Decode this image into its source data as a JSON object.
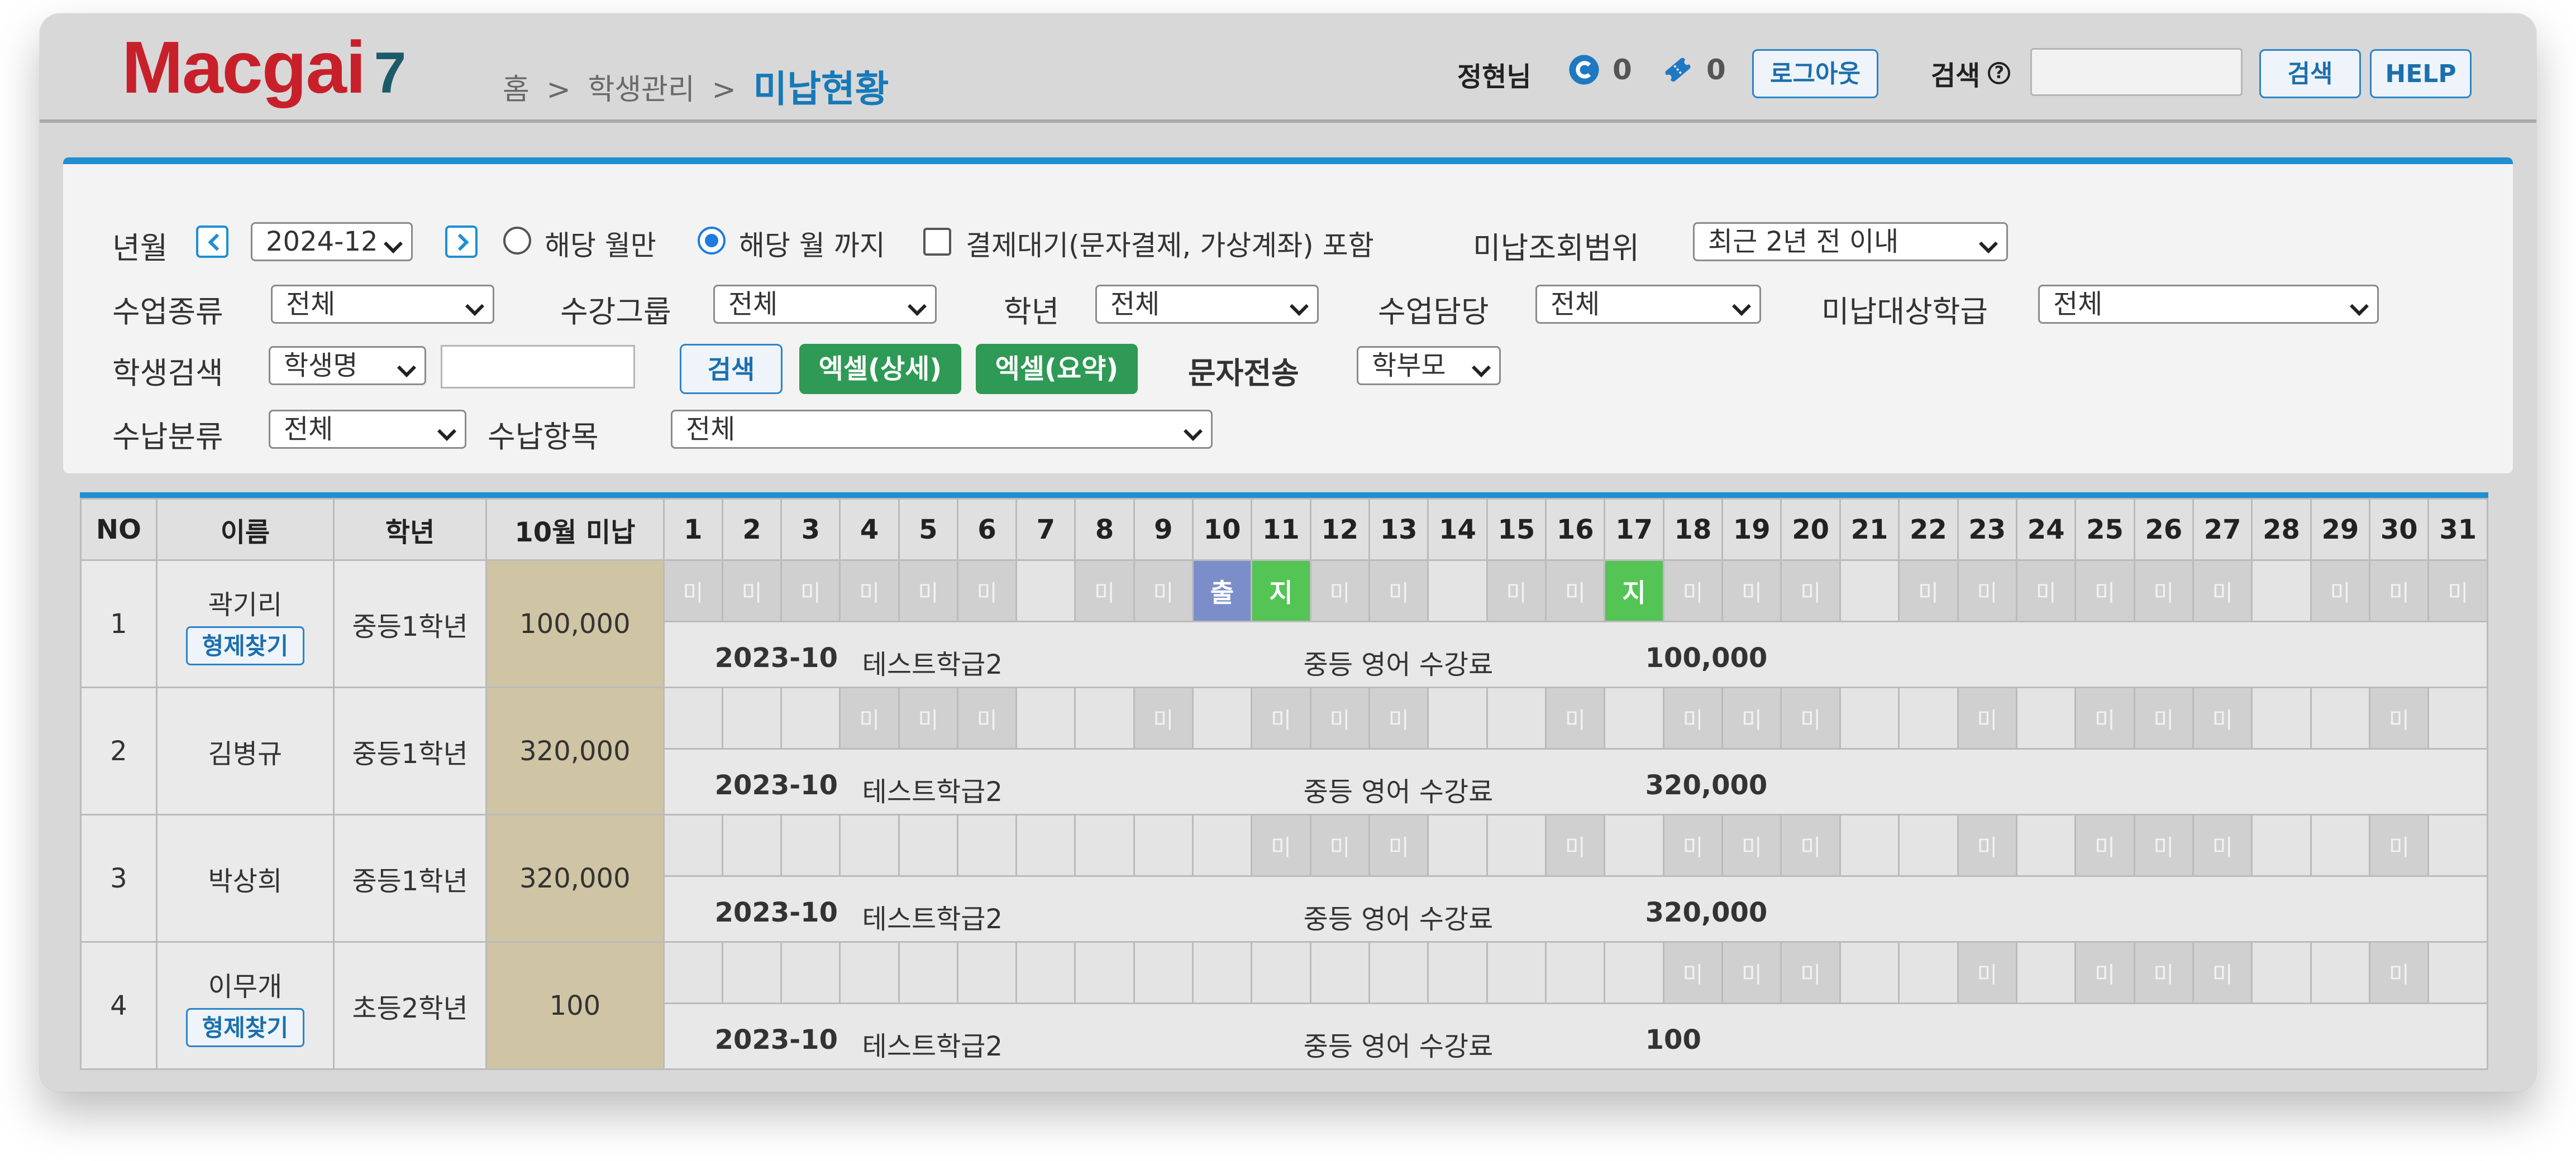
{
  "header": {
    "logo_main": "Macgai",
    "logo_num": "7",
    "breadcrumb": {
      "home": "홈",
      "sep1": ">",
      "section": "학생관리",
      "sep2": ">",
      "current": "미납현황"
    },
    "user_name": "정현님",
    "stat_1_value": "0",
    "stat_1_icon": "coin-icon",
    "stat_2_value": "0",
    "stat_2_icon": "ticket-icon",
    "logout_label": "로그아웃",
    "search_label": "검색",
    "search_help_glyph": "?",
    "search_button": "검색",
    "help_button": "HELP"
  },
  "filters": {
    "year_month_label": "년월",
    "year_month_value": "2024-12",
    "radio_month_only": "해당 월만",
    "radio_until_month": "해당 월 까지",
    "pending_checkbox_label": "결제대기(문자결제, 가상계좌) 포함",
    "range_label": "미납조회범위",
    "range_value": "최근 2년 전 이내",
    "class_type_label": "수업종류",
    "class_type_value": "전체",
    "group_label": "수강그룹",
    "group_value": "전체",
    "grade_label": "학년",
    "grade_value": "전체",
    "teacher_label": "수업담당",
    "teacher_value": "전체",
    "target_class_label": "미납대상학급",
    "target_class_value": "전체",
    "student_search_label": "학생검색",
    "student_search_field": "학생명",
    "search_button": "검색",
    "excel_detail_button": "엑셀(상세)",
    "excel_summary_button": "엑셀(요약)",
    "sms_label": "문자전송",
    "sms_target": "학부모",
    "payment_type_label": "수납분류",
    "payment_type_value": "전체",
    "payment_item_label": "수납항목",
    "payment_item_value": "전체"
  },
  "table": {
    "headers": {
      "no": "NO",
      "name": "이름",
      "grade": "학년",
      "unpaid": "10월 미납"
    },
    "days": [
      "1",
      "2",
      "3",
      "4",
      "5",
      "6",
      "7",
      "8",
      "9",
      "10",
      "11",
      "12",
      "13",
      "14",
      "15",
      "16",
      "17",
      "18",
      "19",
      "20",
      "21",
      "22",
      "23",
      "24",
      "25",
      "26",
      "27",
      "28",
      "29",
      "30",
      "31"
    ],
    "sibling_button": "형제찾기",
    "mark_unpaid": "미",
    "mark_attend": "출",
    "mark_late": "지",
    "rows": [
      {
        "no": "1",
        "name": "곽기리",
        "has_sibling": true,
        "grade": "중등1학년",
        "unpaid": "100,000",
        "days": [
          "미",
          "미",
          "미",
          "미",
          "미",
          "미",
          "",
          "미",
          "미",
          "출",
          "지",
          "미",
          "미",
          "",
          "미",
          "미",
          "지",
          "미",
          "미",
          "미",
          "",
          "미",
          "미",
          "미",
          "미",
          "미",
          "미",
          "",
          "미",
          "미",
          "미"
        ],
        "detail": {
          "ym": "2023-10",
          "class": "테스트학급2",
          "item": "중등 영어 수강료",
          "amount": "100,000"
        }
      },
      {
        "no": "2",
        "name": "김병규",
        "has_sibling": false,
        "grade": "중등1학년",
        "unpaid": "320,000",
        "days": [
          "",
          "",
          "",
          "미",
          "미",
          "미",
          "",
          "",
          "미",
          "",
          "미",
          "미",
          "미",
          "",
          "",
          "미",
          "",
          "미",
          "미",
          "미",
          "",
          "",
          "미",
          "",
          "미",
          "미",
          "미",
          "",
          "",
          "미",
          ""
        ],
        "detail": {
          "ym": "2023-10",
          "class": "테스트학급2",
          "item": "중등 영어 수강료",
          "amount": "320,000"
        }
      },
      {
        "no": "3",
        "name": "박상희",
        "has_sibling": false,
        "grade": "중등1학년",
        "unpaid": "320,000",
        "days": [
          "",
          "",
          "",
          "",
          "",
          "",
          "",
          "",
          "",
          "",
          "미",
          "미",
          "미",
          "",
          "",
          "미",
          "",
          "미",
          "미",
          "미",
          "",
          "",
          "미",
          "",
          "미",
          "미",
          "미",
          "",
          "",
          "미",
          ""
        ],
        "detail": {
          "ym": "2023-10",
          "class": "테스트학급2",
          "item": "중등 영어 수강료",
          "amount": "320,000"
        }
      },
      {
        "no": "4",
        "name": "이무개",
        "has_sibling": true,
        "grade": "초등2학년",
        "unpaid": "100",
        "days": [
          "",
          "",
          "",
          "",
          "",
          "",
          "",
          "",
          "",
          "",
          "",
          "",
          "",
          "",
          "",
          "",
          "",
          "미",
          "미",
          "미",
          "",
          "",
          "미",
          "",
          "미",
          "미",
          "미",
          "",
          "",
          "미",
          ""
        ],
        "detail": {
          "ym": "2023-10",
          "class": "테스트학급2",
          "item": "중등 영어 수강료",
          "amount": "100"
        }
      }
    ]
  },
  "colors": {
    "accent_blue": "#1f8fd1",
    "logo_red": "#c8202a",
    "excel_green": "#2e9a55",
    "attend_blue": "#7b8ec9",
    "late_green": "#54c454",
    "unpaid_cell": "#d0d0d0",
    "unpaid_amount_bg": "#cfc5a4"
  }
}
